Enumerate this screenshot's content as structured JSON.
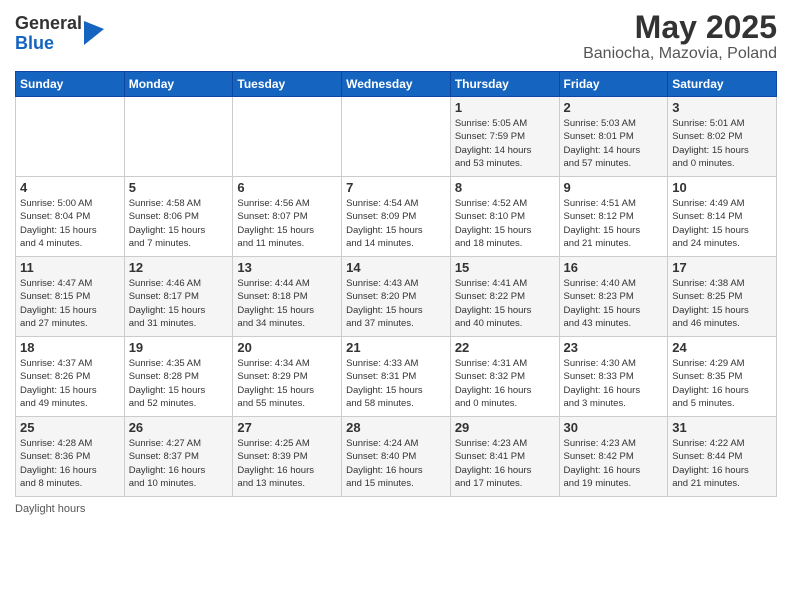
{
  "header": {
    "logo_general": "General",
    "logo_blue": "Blue",
    "title": "May 2025",
    "subtitle": "Baniocha, Mazovia, Poland"
  },
  "days_of_week": [
    "Sunday",
    "Monday",
    "Tuesday",
    "Wednesday",
    "Thursday",
    "Friday",
    "Saturday"
  ],
  "weeks": [
    [
      {
        "num": "",
        "info": ""
      },
      {
        "num": "",
        "info": ""
      },
      {
        "num": "",
        "info": ""
      },
      {
        "num": "",
        "info": ""
      },
      {
        "num": "1",
        "info": "Sunrise: 5:05 AM\nSunset: 7:59 PM\nDaylight: 14 hours\nand 53 minutes."
      },
      {
        "num": "2",
        "info": "Sunrise: 5:03 AM\nSunset: 8:01 PM\nDaylight: 14 hours\nand 57 minutes."
      },
      {
        "num": "3",
        "info": "Sunrise: 5:01 AM\nSunset: 8:02 PM\nDaylight: 15 hours\nand 0 minutes."
      }
    ],
    [
      {
        "num": "4",
        "info": "Sunrise: 5:00 AM\nSunset: 8:04 PM\nDaylight: 15 hours\nand 4 minutes."
      },
      {
        "num": "5",
        "info": "Sunrise: 4:58 AM\nSunset: 8:06 PM\nDaylight: 15 hours\nand 7 minutes."
      },
      {
        "num": "6",
        "info": "Sunrise: 4:56 AM\nSunset: 8:07 PM\nDaylight: 15 hours\nand 11 minutes."
      },
      {
        "num": "7",
        "info": "Sunrise: 4:54 AM\nSunset: 8:09 PM\nDaylight: 15 hours\nand 14 minutes."
      },
      {
        "num": "8",
        "info": "Sunrise: 4:52 AM\nSunset: 8:10 PM\nDaylight: 15 hours\nand 18 minutes."
      },
      {
        "num": "9",
        "info": "Sunrise: 4:51 AM\nSunset: 8:12 PM\nDaylight: 15 hours\nand 21 minutes."
      },
      {
        "num": "10",
        "info": "Sunrise: 4:49 AM\nSunset: 8:14 PM\nDaylight: 15 hours\nand 24 minutes."
      }
    ],
    [
      {
        "num": "11",
        "info": "Sunrise: 4:47 AM\nSunset: 8:15 PM\nDaylight: 15 hours\nand 27 minutes."
      },
      {
        "num": "12",
        "info": "Sunrise: 4:46 AM\nSunset: 8:17 PM\nDaylight: 15 hours\nand 31 minutes."
      },
      {
        "num": "13",
        "info": "Sunrise: 4:44 AM\nSunset: 8:18 PM\nDaylight: 15 hours\nand 34 minutes."
      },
      {
        "num": "14",
        "info": "Sunrise: 4:43 AM\nSunset: 8:20 PM\nDaylight: 15 hours\nand 37 minutes."
      },
      {
        "num": "15",
        "info": "Sunrise: 4:41 AM\nSunset: 8:22 PM\nDaylight: 15 hours\nand 40 minutes."
      },
      {
        "num": "16",
        "info": "Sunrise: 4:40 AM\nSunset: 8:23 PM\nDaylight: 15 hours\nand 43 minutes."
      },
      {
        "num": "17",
        "info": "Sunrise: 4:38 AM\nSunset: 8:25 PM\nDaylight: 15 hours\nand 46 minutes."
      }
    ],
    [
      {
        "num": "18",
        "info": "Sunrise: 4:37 AM\nSunset: 8:26 PM\nDaylight: 15 hours\nand 49 minutes."
      },
      {
        "num": "19",
        "info": "Sunrise: 4:35 AM\nSunset: 8:28 PM\nDaylight: 15 hours\nand 52 minutes."
      },
      {
        "num": "20",
        "info": "Sunrise: 4:34 AM\nSunset: 8:29 PM\nDaylight: 15 hours\nand 55 minutes."
      },
      {
        "num": "21",
        "info": "Sunrise: 4:33 AM\nSunset: 8:31 PM\nDaylight: 15 hours\nand 58 minutes."
      },
      {
        "num": "22",
        "info": "Sunrise: 4:31 AM\nSunset: 8:32 PM\nDaylight: 16 hours\nand 0 minutes."
      },
      {
        "num": "23",
        "info": "Sunrise: 4:30 AM\nSunset: 8:33 PM\nDaylight: 16 hours\nand 3 minutes."
      },
      {
        "num": "24",
        "info": "Sunrise: 4:29 AM\nSunset: 8:35 PM\nDaylight: 16 hours\nand 5 minutes."
      }
    ],
    [
      {
        "num": "25",
        "info": "Sunrise: 4:28 AM\nSunset: 8:36 PM\nDaylight: 16 hours\nand 8 minutes."
      },
      {
        "num": "26",
        "info": "Sunrise: 4:27 AM\nSunset: 8:37 PM\nDaylight: 16 hours\nand 10 minutes."
      },
      {
        "num": "27",
        "info": "Sunrise: 4:25 AM\nSunset: 8:39 PM\nDaylight: 16 hours\nand 13 minutes."
      },
      {
        "num": "28",
        "info": "Sunrise: 4:24 AM\nSunset: 8:40 PM\nDaylight: 16 hours\nand 15 minutes."
      },
      {
        "num": "29",
        "info": "Sunrise: 4:23 AM\nSunset: 8:41 PM\nDaylight: 16 hours\nand 17 minutes."
      },
      {
        "num": "30",
        "info": "Sunrise: 4:23 AM\nSunset: 8:42 PM\nDaylight: 16 hours\nand 19 minutes."
      },
      {
        "num": "31",
        "info": "Sunrise: 4:22 AM\nSunset: 8:44 PM\nDaylight: 16 hours\nand 21 minutes."
      }
    ]
  ],
  "footer": {
    "label": "Daylight hours"
  }
}
